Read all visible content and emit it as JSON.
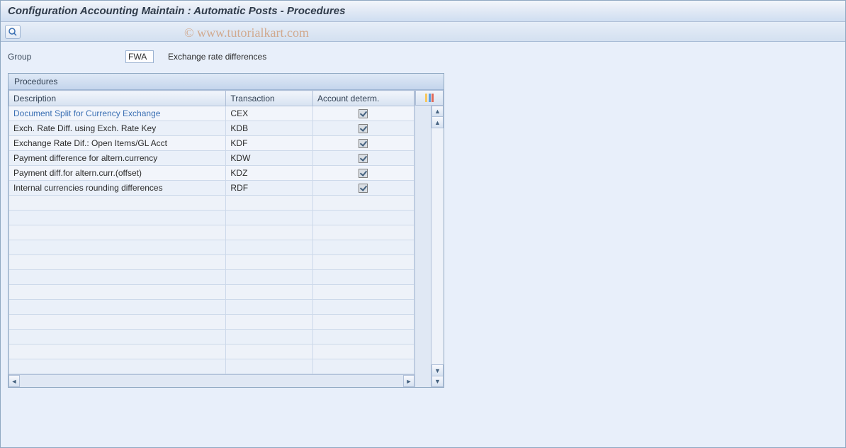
{
  "title": "Configuration Accounting Maintain : Automatic Posts - Procedures",
  "watermark": "© www.tutorialkart.com",
  "group": {
    "label": "Group",
    "value": "FWA",
    "desc": "Exchange rate differences"
  },
  "panel": {
    "title": "Procedures",
    "columns": {
      "description": "Description",
      "transaction": "Transaction",
      "account_determ": "Account determ."
    },
    "rows": [
      {
        "description": "Document Split for Currency Exchange",
        "transaction": "CEX",
        "account_determ": true,
        "link": true
      },
      {
        "description": "Exch. Rate Diff. using Exch. Rate Key",
        "transaction": "KDB",
        "account_determ": true
      },
      {
        "description": "Exchange Rate Dif.: Open Items/GL Acct",
        "transaction": "KDF",
        "account_determ": true
      },
      {
        "description": "Payment difference for altern.currency",
        "transaction": "KDW",
        "account_determ": true
      },
      {
        "description": "Payment diff.for altern.curr.(offset)",
        "transaction": "KDZ",
        "account_determ": true
      },
      {
        "description": "Internal currencies rounding differences",
        "transaction": "RDF",
        "account_determ": true
      }
    ],
    "empty_rows": 12
  }
}
